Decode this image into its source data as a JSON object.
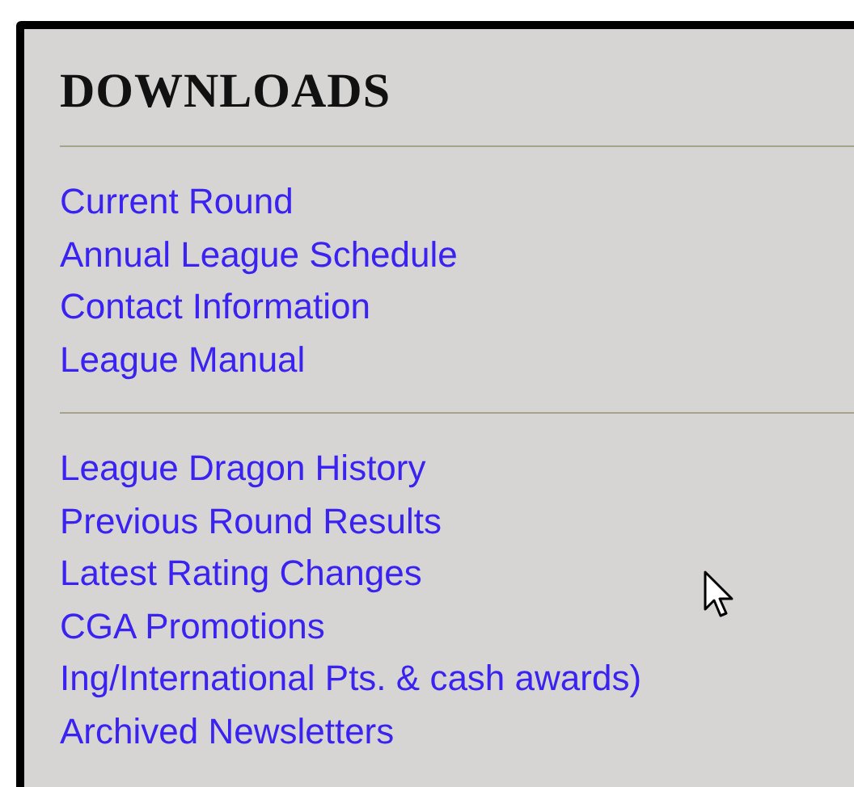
{
  "panel": {
    "title": "DOWNLOADS",
    "sections": [
      {
        "links": [
          "Current Round",
          "Annual League Schedule",
          "Contact Information",
          "League Manual"
        ]
      },
      {
        "links": [
          "League Dragon History",
          "Previous Round Results",
          "Latest Rating Changes",
          "CGA Promotions",
          "Ing/International Pts. & cash awards)",
          "Archived Newsletters"
        ]
      }
    ]
  }
}
